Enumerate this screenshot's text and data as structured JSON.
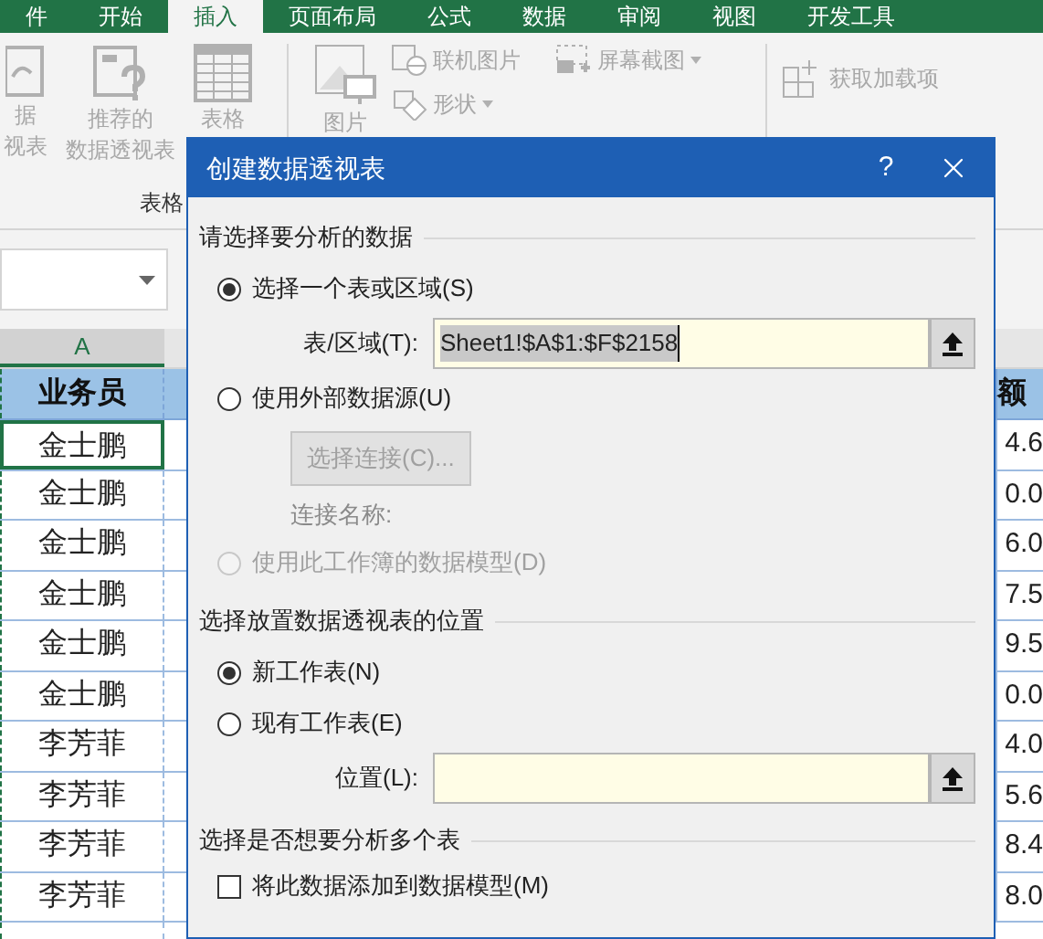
{
  "ribbon_tabs": [
    {
      "label": "件",
      "selected": false
    },
    {
      "label": "开始",
      "selected": false
    },
    {
      "label": "插入",
      "selected": true
    },
    {
      "label": "页面布局",
      "selected": false
    },
    {
      "label": "公式",
      "selected": false
    },
    {
      "label": "数据",
      "selected": false
    },
    {
      "label": "审阅",
      "selected": false
    },
    {
      "label": "视图",
      "selected": false
    },
    {
      "label": "开发工具",
      "selected": false
    }
  ],
  "ribbon": {
    "group_label": "表格",
    "large_buttons": [
      {
        "kind": "pivot",
        "lines": [
          "据",
          "视表"
        ]
      },
      {
        "kind": "recommended",
        "lines": [
          "推荐的",
          "数据透视表"
        ]
      },
      {
        "kind": "table",
        "lines": [
          "表格"
        ]
      },
      {
        "kind": "picture",
        "lines": [
          "图片"
        ]
      }
    ],
    "small_buttons": [
      {
        "kind": "online-picture",
        "label": "联机图片",
        "dropdown": false
      },
      {
        "kind": "shapes",
        "label": "形状",
        "dropdown": true
      },
      {
        "kind": "screenshot",
        "label": "屏幕截图",
        "dropdown": true
      },
      {
        "kind": "addins",
        "label": "获取加载项",
        "dropdown": false
      }
    ]
  },
  "sheet": {
    "column_header": "A",
    "header_cell": "业务员",
    "right_header": "额",
    "rows": [
      {
        "name": "金士鹏",
        "value": "4.6"
      },
      {
        "name": "金士鹏",
        "value": "0.0"
      },
      {
        "name": "金士鹏",
        "value": "6.0"
      },
      {
        "name": "金士鹏",
        "value": "7.5"
      },
      {
        "name": "金士鹏",
        "value": "9.5"
      },
      {
        "name": "金士鹏",
        "value": "0.0"
      },
      {
        "name": "李芳菲",
        "value": "4.0"
      },
      {
        "name": "李芳菲",
        "value": "5.6"
      },
      {
        "name": "李芳菲",
        "value": "8.4"
      },
      {
        "name": "李芳菲",
        "value": "8.0"
      }
    ]
  },
  "dialog": {
    "title": "创建数据透视表",
    "help": "?",
    "sections": [
      {
        "title": "请选择要分析的数据",
        "items": [
          {
            "kind": "radio",
            "label": "选择一个表或区域(S)",
            "selected": true,
            "disabled": false
          },
          {
            "kind": "field",
            "label": "表/区域(T):",
            "value": "Sheet1!$A$1:$F$2158"
          },
          {
            "kind": "radio",
            "label": "使用外部数据源(U)",
            "selected": false,
            "disabled": false
          },
          {
            "kind": "button",
            "label": "选择连接(C)..."
          },
          {
            "kind": "caption",
            "label": "连接名称:"
          },
          {
            "kind": "radio",
            "label": "使用此工作簿的数据模型(D)",
            "selected": false,
            "disabled": true
          }
        ]
      },
      {
        "title": "选择放置数据透视表的位置",
        "items": [
          {
            "kind": "radio",
            "label": "新工作表(N)",
            "selected": true,
            "disabled": false
          },
          {
            "kind": "radio",
            "label": "现有工作表(E)",
            "selected": false,
            "disabled": false
          },
          {
            "kind": "field",
            "label": "位置(L):"
          }
        ]
      },
      {
        "title": "选择是否想要分析多个表",
        "items": [
          {
            "kind": "checkbox",
            "label": "将此数据添加到数据模型(M)",
            "checked": false
          }
        ]
      }
    ]
  }
}
